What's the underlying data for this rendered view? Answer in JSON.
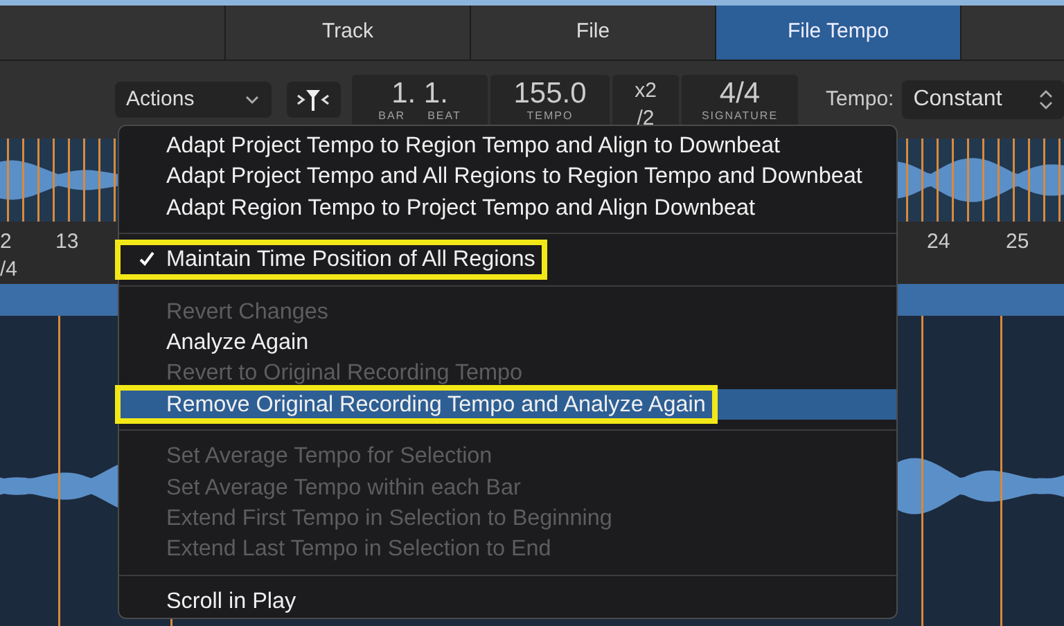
{
  "tabs": [
    {
      "label": "Track",
      "selected": false
    },
    {
      "label": "File",
      "selected": false
    },
    {
      "label": "File Tempo",
      "selected": true
    }
  ],
  "toolbar": {
    "actions": {
      "label": "Actions"
    },
    "lcd": {
      "bar_beat": {
        "value": "1. 1.",
        "captions": [
          "BAR",
          "BEAT"
        ]
      },
      "tempo": {
        "value": "155.0",
        "caption": "TEMPO"
      },
      "multiplier": {
        "top": "x2",
        "bottom": "/2"
      },
      "signature": {
        "value": "4/4",
        "caption": "SIGNATURE"
      }
    },
    "tempo_mode": {
      "label": "Tempo:",
      "value": "Constant"
    }
  },
  "ruler": {
    "left_labels": [
      "2",
      "13"
    ],
    "signature": "/4",
    "right_labels": [
      "24",
      "25"
    ]
  },
  "menu": {
    "items": [
      {
        "kind": "item",
        "label": "Adapt Project Tempo to Region Tempo and Align to Downbeat",
        "disabled": false,
        "checked": false,
        "selected": false,
        "outlined": false
      },
      {
        "kind": "item",
        "label": "Adapt Project Tempo and All Regions to Region Tempo and Downbeat",
        "disabled": false,
        "checked": false,
        "selected": false,
        "outlined": false
      },
      {
        "kind": "item",
        "label": "Adapt Region Tempo to Project Tempo and Align Downbeat",
        "disabled": false,
        "checked": false,
        "selected": false,
        "outlined": false
      },
      {
        "kind": "separator"
      },
      {
        "kind": "item",
        "label": "Maintain Time Position of All Regions",
        "disabled": false,
        "checked": true,
        "selected": false,
        "outlined": true
      },
      {
        "kind": "separator"
      },
      {
        "kind": "item",
        "label": "Revert Changes",
        "disabled": true,
        "checked": false,
        "selected": false,
        "outlined": false
      },
      {
        "kind": "item",
        "label": "Analyze Again",
        "disabled": false,
        "checked": false,
        "selected": false,
        "outlined": false
      },
      {
        "kind": "item",
        "label": "Revert to Original Recording Tempo",
        "disabled": true,
        "checked": false,
        "selected": false,
        "outlined": false
      },
      {
        "kind": "item",
        "label": "Remove Original Recording Tempo and Analyze Again",
        "disabled": false,
        "checked": false,
        "selected": true,
        "outlined": true
      },
      {
        "kind": "separator"
      },
      {
        "kind": "item",
        "label": "Set Average Tempo for Selection",
        "disabled": true,
        "checked": false,
        "selected": false,
        "outlined": false
      },
      {
        "kind": "item",
        "label": "Set Average Tempo within each Bar",
        "disabled": true,
        "checked": false,
        "selected": false,
        "outlined": false
      },
      {
        "kind": "item",
        "label": "Extend First Tempo in Selection to Beginning",
        "disabled": true,
        "checked": false,
        "selected": false,
        "outlined": false
      },
      {
        "kind": "item",
        "label": "Extend Last Tempo in Selection to End",
        "disabled": true,
        "checked": false,
        "selected": false,
        "outlined": false
      },
      {
        "kind": "separator"
      },
      {
        "kind": "item",
        "label": "Scroll in Play",
        "disabled": false,
        "checked": false,
        "selected": false,
        "outlined": false
      }
    ]
  }
}
